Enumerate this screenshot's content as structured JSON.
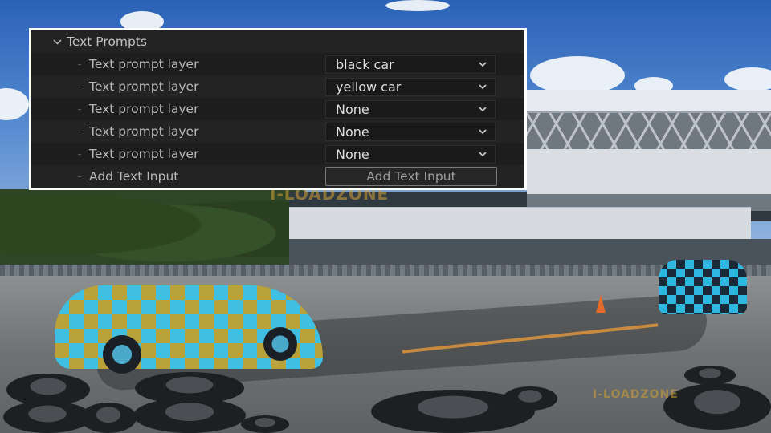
{
  "panel": {
    "group_title": "Text Prompts",
    "rows": [
      {
        "label": "Text prompt layer",
        "value": "black car"
      },
      {
        "label": "Text prompt layer",
        "value": "yellow car"
      },
      {
        "label": "Text prompt layer",
        "value": "None"
      },
      {
        "label": "Text prompt layer",
        "value": "None"
      },
      {
        "label": "Text prompt layer",
        "value": "None"
      }
    ],
    "add_row": {
      "label": "Add Text Input",
      "button_label": "Add Text Input"
    },
    "icons": {
      "group": "chevron-down-icon",
      "dropdown": "chevron-down-icon"
    }
  },
  "watermarks": {
    "center": "I-LOADZONE",
    "bottom_right": "I-LOADZONE"
  },
  "colors": {
    "panel_bg": "#232323",
    "panel_border": "#ffffff",
    "overlay_cyan": "#3fc0e2",
    "watermark": "#d2a437"
  }
}
